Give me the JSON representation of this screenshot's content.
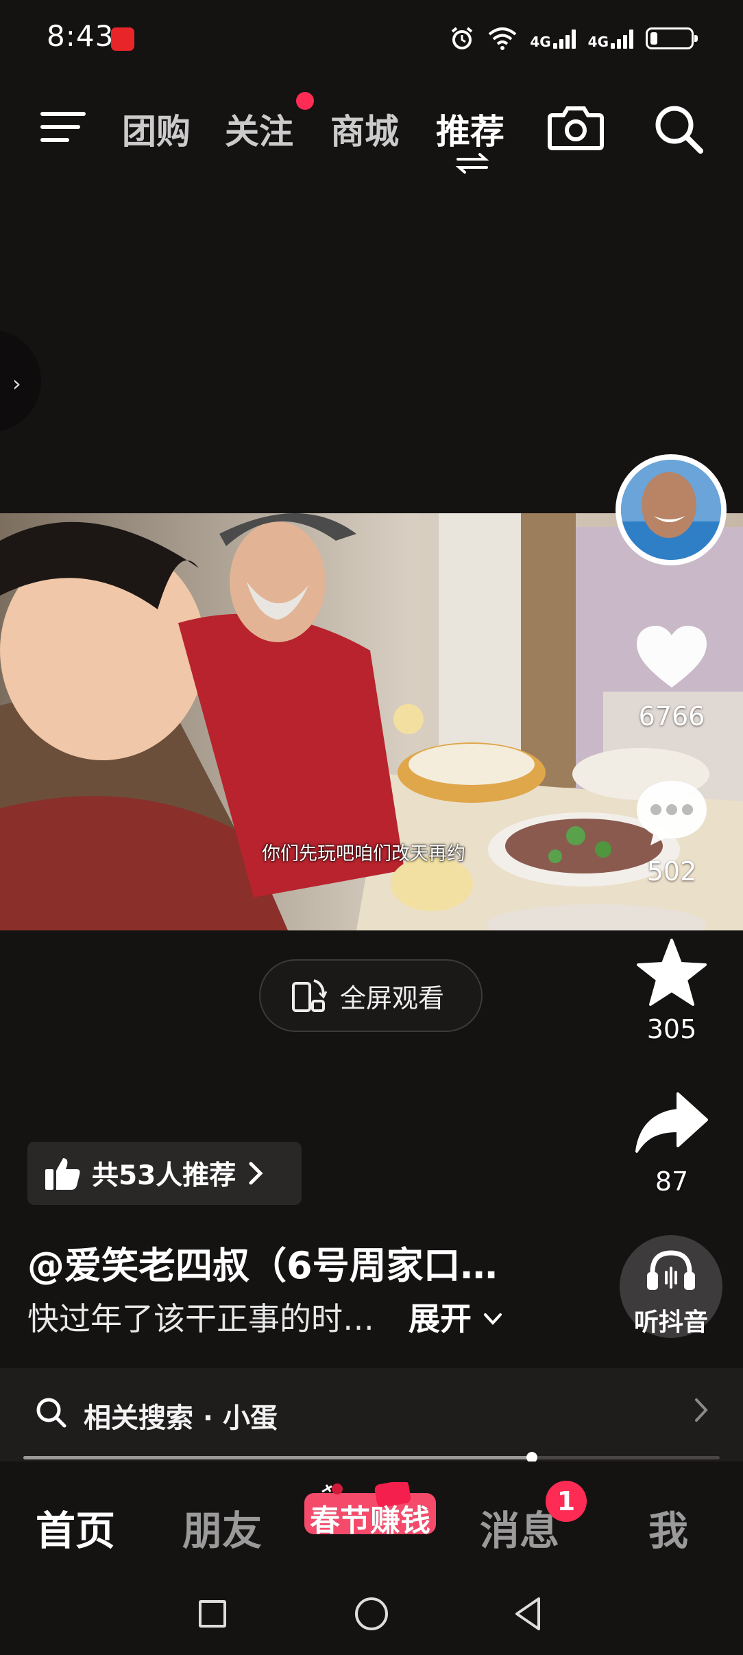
{
  "status_bar": {
    "time": "8:43",
    "network_labels": [
      "4G",
      "4G"
    ]
  },
  "top_nav": {
    "tabs": [
      {
        "id": "tuangou",
        "label": "团购"
      },
      {
        "id": "guanzhu",
        "label": "关注"
      },
      {
        "id": "shangcheng",
        "label": "商城"
      },
      {
        "id": "tuijian",
        "label": "推荐"
      }
    ],
    "active_tab": "推荐",
    "icons": [
      "menu-icon",
      "camera-icon",
      "search-icon"
    ]
  },
  "video": {
    "subtitle": "你们先玩吧咱们改天再约",
    "fullscreen_label": "全屏观看"
  },
  "actions": {
    "like_count": "6766",
    "comment_count": "502",
    "favorite_count": "305",
    "share_count": "87",
    "listen_label": "听抖音"
  },
  "info": {
    "recommend_label": "共53人推荐",
    "author": "@爱笑老四叔（6号周家口…",
    "description": "快过年了该干正事的时…",
    "expand_label": "展开"
  },
  "related_search": {
    "label": "相关搜索 · 小蛋"
  },
  "playback": {
    "progress_fraction": 0.73
  },
  "bottom_tabs": {
    "home": "首页",
    "friends": "朋友",
    "earn": "春节赚钱",
    "messages": "消息",
    "messages_badge": "1",
    "me": "我"
  },
  "colors": {
    "background": "#151212",
    "accent_red": "#fe2c55"
  }
}
